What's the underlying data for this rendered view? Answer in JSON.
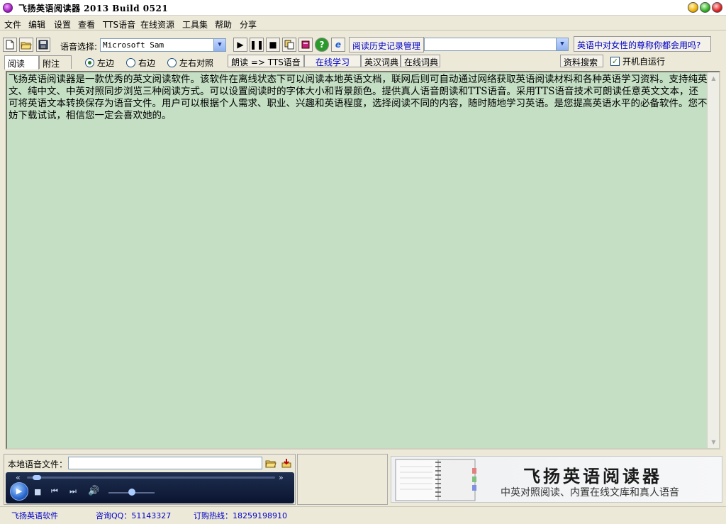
{
  "app": {
    "title": "飞扬英语阅读器 2013 Build 0521"
  },
  "menu": [
    "文件",
    "编辑",
    "设置",
    "查看",
    "TTS语音",
    "在线资源",
    "工具集",
    "帮助",
    "分享"
  ],
  "toolbar": {
    "voice_label": "语音选择:",
    "voice_value": "Microsoft Sam",
    "history_link": "阅读历史记录管理",
    "history_combo": "",
    "question_link": "英语中对女性的尊称你都会用吗?",
    "icons": [
      "new-file-icon",
      "open-folder-icon",
      "save-icon",
      "play-icon",
      "pause-icon",
      "stop-icon",
      "copy-icon",
      "book-icon",
      "help-icon",
      "ie-icon"
    ]
  },
  "tabs": [
    "阅读",
    "附注"
  ],
  "options": {
    "radios": [
      "左边",
      "右边",
      "左右对照"
    ],
    "selected_radio": "左边",
    "read_btn": "朗读 => TTS语音",
    "online_learn": "在线学习",
    "en_cn_dict": "英汉词典",
    "online_dict": "在线词典",
    "search_btn": "资料搜索",
    "autorun_label": "开机自运行",
    "autorun_checked": true
  },
  "content": {
    "text": "飞扬英语阅读器是一款优秀的英文阅读软件。该软件在离线状态下可以阅读本地英语文档，联网后则可自动通过网络获取英语阅读材料和各种英语学习资料。支持纯英文、纯中文、中英对照同步浏览三种阅读方式。可以设置阅读时的字体大小和背景颜色。提供真人语音朗读和TTS语音。采用TTS语音技术可朗读任意英文文本，还可将英语文本转换保存为语音文件。用户可以根据个人需求、职业、兴趣和英语程度，选择阅读不同的内容，随时随地学习英语。是您提高英语水平的必备软件。您不妨下载试试，相信您一定会喜欢她的。"
  },
  "audio": {
    "label": "本地语音文件：",
    "file": "",
    "seek_fraction": 0.04,
    "volume_fraction": 0.5
  },
  "banner": {
    "title": "飞扬英语阅读器",
    "subtitle": "中英对照阅读、内置在线文库和真人语音"
  },
  "status": {
    "software": "飞扬英语软件",
    "qq": "咨询QQ：51143327",
    "hotline": "订购热线：18259198910"
  }
}
